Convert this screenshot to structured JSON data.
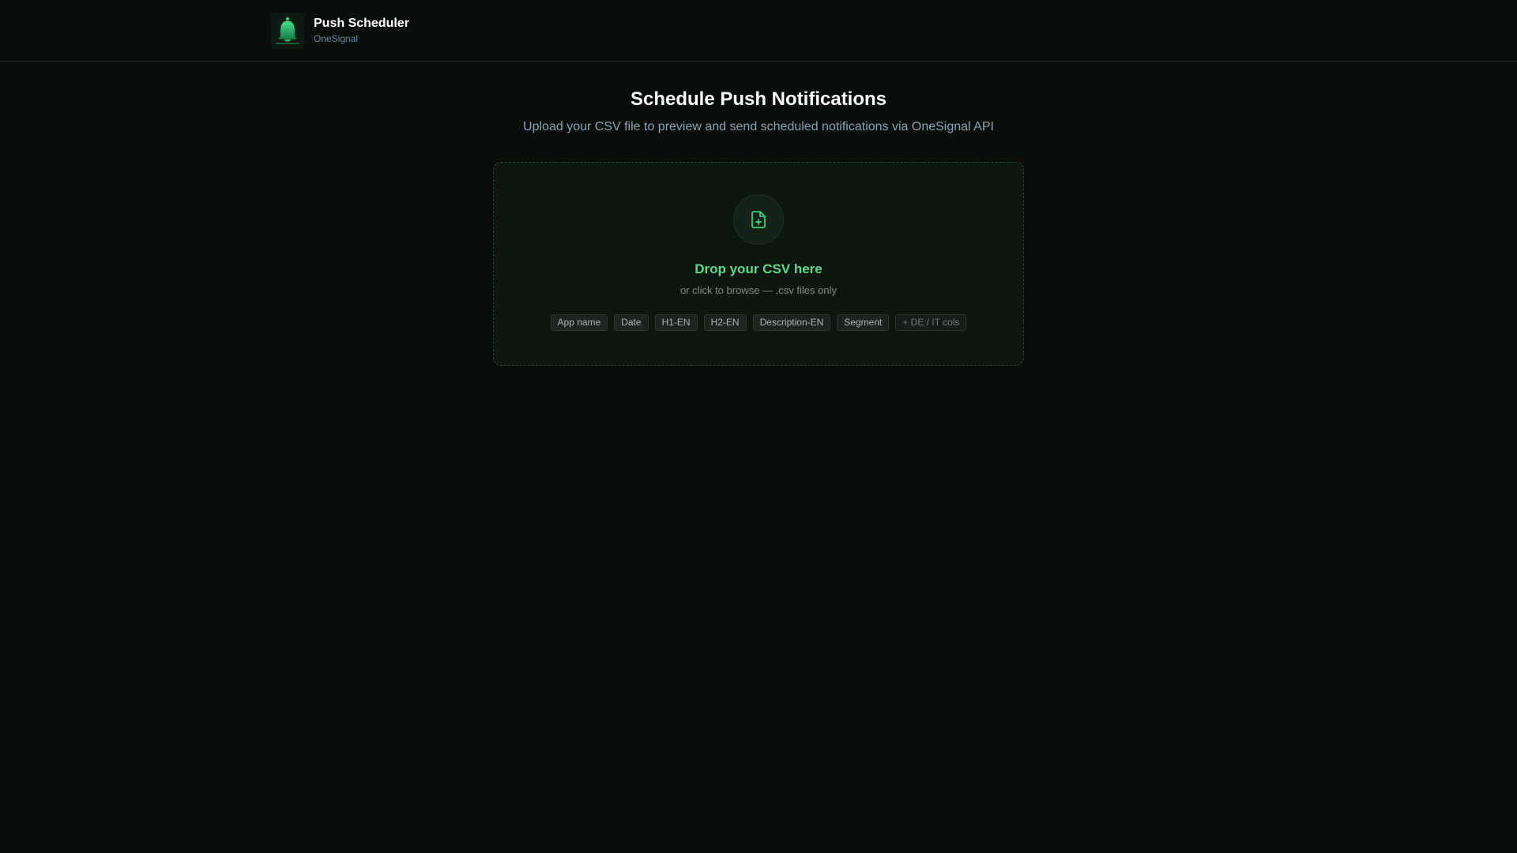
{
  "header": {
    "title": "Push Scheduler",
    "subtitle": "OneSignal",
    "logo_icon": "bell-icon"
  },
  "main": {
    "title": "Schedule Push Notifications",
    "subtitle": "Upload your CSV file to preview and send scheduled notifications via OneSignal API"
  },
  "dropzone": {
    "icon": "file-plus-icon",
    "title": "Drop your CSV here",
    "hint": "or click to browse — .csv files only",
    "columns": [
      "App name",
      "Date",
      "H1-EN",
      "H2-EN",
      "Description-EN",
      "Segment"
    ],
    "extra_columns": "+ DE / IT cols"
  },
  "colors": {
    "background": "#0a0e0b",
    "accent": "#5fd98e",
    "border": "#214a30"
  }
}
